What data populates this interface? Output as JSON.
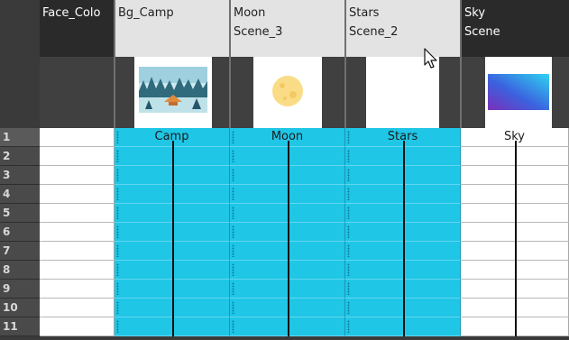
{
  "columns": [
    {
      "name": "Face_Colo",
      "drawing": ""
    },
    {
      "name": "Bg_Camp",
      "drawing": ""
    },
    {
      "name": "Moon",
      "drawing": "Scene_3"
    },
    {
      "name": "Stars",
      "drawing": "Scene_2"
    },
    {
      "name": "Sky",
      "drawing": "Scene"
    }
  ],
  "frames": [
    "1",
    "2",
    "3",
    "4",
    "5",
    "6",
    "7",
    "8",
    "9",
    "10",
    "11"
  ],
  "cells": {
    "bg_camp": "Camp",
    "moon": "Moon",
    "stars": "Stars",
    "sky": "Sky"
  },
  "icons": {
    "bg_camp_thumb": "camp-scene-thumbnail-icon",
    "moon_thumb": "moon-thumbnail-icon",
    "stars_thumb": "stars-thumbnail-icon",
    "sky_thumb": "sky-gradient-thumbnail-icon",
    "cursor": "mouse-pointer-icon"
  },
  "colors": {
    "exposure_cell": "#1fc6e6",
    "header_gray": "#e3e3e3",
    "header_dark": "#2a2a2a",
    "frame_column": "#4a4a4a"
  }
}
